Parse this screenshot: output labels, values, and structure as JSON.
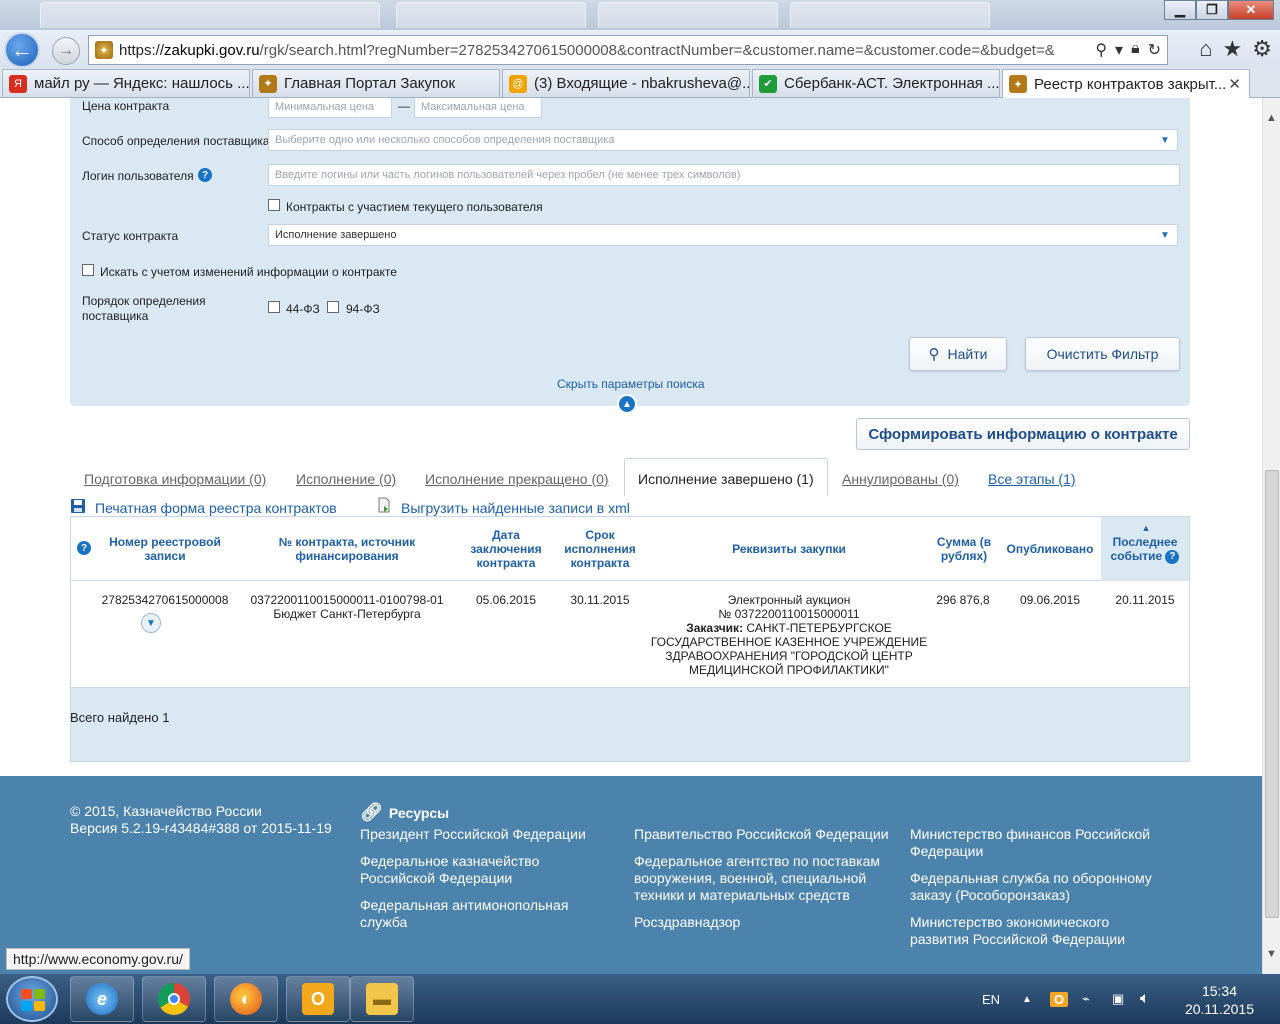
{
  "browser": {
    "url_prefix": "https://",
    "url_host": "zakupki.gov.ru",
    "url_rest": "/rgk/search.html?regNumber=2782534270615000008&contractNumber=&customer.name=&customer.code=&budget=&",
    "tabs": [
      {
        "label": "майл ру — Яндекс: нашлось ...",
        "icon": "yandex-icon",
        "color": "#d82e1f"
      },
      {
        "label": "Главная Портал Закупок",
        "icon": "emblem-icon",
        "color": "#b07a1a"
      },
      {
        "label": "(3) Входящие - nbakrusheva@...",
        "icon": "mail-icon",
        "color": "#f0a400"
      },
      {
        "label": "Сбербанк-АСТ. Электронная ...",
        "icon": "sberbank-icon",
        "color": "#1f9b3a"
      },
      {
        "label": "Реестр контрактов закрыт...",
        "icon": "emblem-icon",
        "color": "#b07a1a"
      }
    ]
  },
  "filters": {
    "price_label": "Цена контракта",
    "price_min_placeholder": "Минимальная цена",
    "price_dash": "—",
    "price_max_placeholder": "Максимальная цена",
    "method_label": "Способ определения поставщика",
    "method_placeholder": "Выберите одно или несколько способов определения поставщика",
    "login_label": "Логин пользователя",
    "login_placeholder": "Введите логины или часть логинов пользователей через пробел (не менее трех символов)",
    "current_user_label": "Контракты с участием текущего пользователя",
    "status_label": "Статус контракта",
    "status_value": "Исполнение завершено",
    "changes_label": "Искать с учетом изменений информации о контракте",
    "order_label_line1": "Порядок определения",
    "order_label_line2": "поставщика",
    "law44": "44-ФЗ",
    "law94": "94-ФЗ",
    "find_button": "Найти",
    "clear_button": "Очистить Фильтр",
    "hide_params": "Скрыть параметры поиска"
  },
  "generate_button": "Сформировать информацию о контракте",
  "tabs": [
    {
      "label": "Подготовка информации (0)"
    },
    {
      "label": "Исполнение (0)"
    },
    {
      "label": "Исполнение прекращено (0)"
    },
    {
      "label": "Исполнение завершено (1)"
    },
    {
      "label": "Аннулированы (0)"
    },
    {
      "label": "Все этапы (1)"
    }
  ],
  "actions": {
    "print": "Печатная форма реестра контрактов",
    "export": "Выгрузить найденные записи в xml"
  },
  "table": {
    "headers": {
      "reg_number": [
        "Номер реестровой",
        "записи"
      ],
      "contract_number": [
        "№ контракта, источник",
        "финансирования"
      ],
      "date": [
        "Дата",
        "заключения",
        "контракта"
      ],
      "term": [
        "Срок",
        "исполнения",
        "контракта"
      ],
      "requisites": "Реквизиты закупки",
      "sum": [
        "Сумма (в",
        "рублях)"
      ],
      "published": "Опубликовано",
      "last_event": [
        "Последнее",
        "событие"
      ]
    },
    "rows": [
      {
        "reg_number": "2782534270615000008",
        "contract_number": "0372200110015000011-0100798-01",
        "funding": "Бюджет Санкт-Петербурга",
        "date": "05.06.2015",
        "term": "30.11.2015",
        "procurement_type": "Электронный аукцион",
        "procurement_number": "№ 0372200110015000011",
        "customer_label": "Заказчик:",
        "customer_line1": "САНКТ-ПЕТЕРБУРГСКОЕ",
        "customer_line2": "ГОСУДАРСТВЕННОЕ КАЗЕННОЕ УЧРЕЖДЕНИЕ",
        "customer_line3": "ЗДРАВООХРАНЕНИЯ \"ГОРОДСКОЙ ЦЕНТР",
        "customer_line4": "МЕДИЦИНСКОЙ ПРОФИЛАКТИКИ\"",
        "sum": "296 876,8",
        "published": "09.06.2015",
        "last_event": "20.11.2015"
      }
    ],
    "total": "Всего найдено 1"
  },
  "footer": {
    "copyright": "© 2015, Казначейство России",
    "version": "Версия 5.2.19-r43484#388 от 2015-11-19",
    "resources_title": "Ресурсы",
    "col1": [
      "Президент Российской Федерации",
      "Федеральное казначейство Российской Федерации",
      "Федеральная антимонопольная служба"
    ],
    "col2": [
      "Правительство Российской Федерации",
      "Федеральное агентство по поставкам вооружения, военной, специальной техники и материальных средств",
      "Росздравнадзор"
    ],
    "col3": [
      "Министерство финансов Российской Федерации",
      "Федеральная служба по оборонному заказу (Рособоронзаказ)",
      "Министерство экономического развития Российской Федерации"
    ]
  },
  "status_url": "http://www.economy.gov.ru/",
  "taskbar": {
    "lang": "EN",
    "time": "15:34",
    "date": "20.11.2015"
  },
  "colors": {
    "panel": "#dae8f3",
    "link": "#1d5fa8",
    "footer": "#4c83ad"
  }
}
